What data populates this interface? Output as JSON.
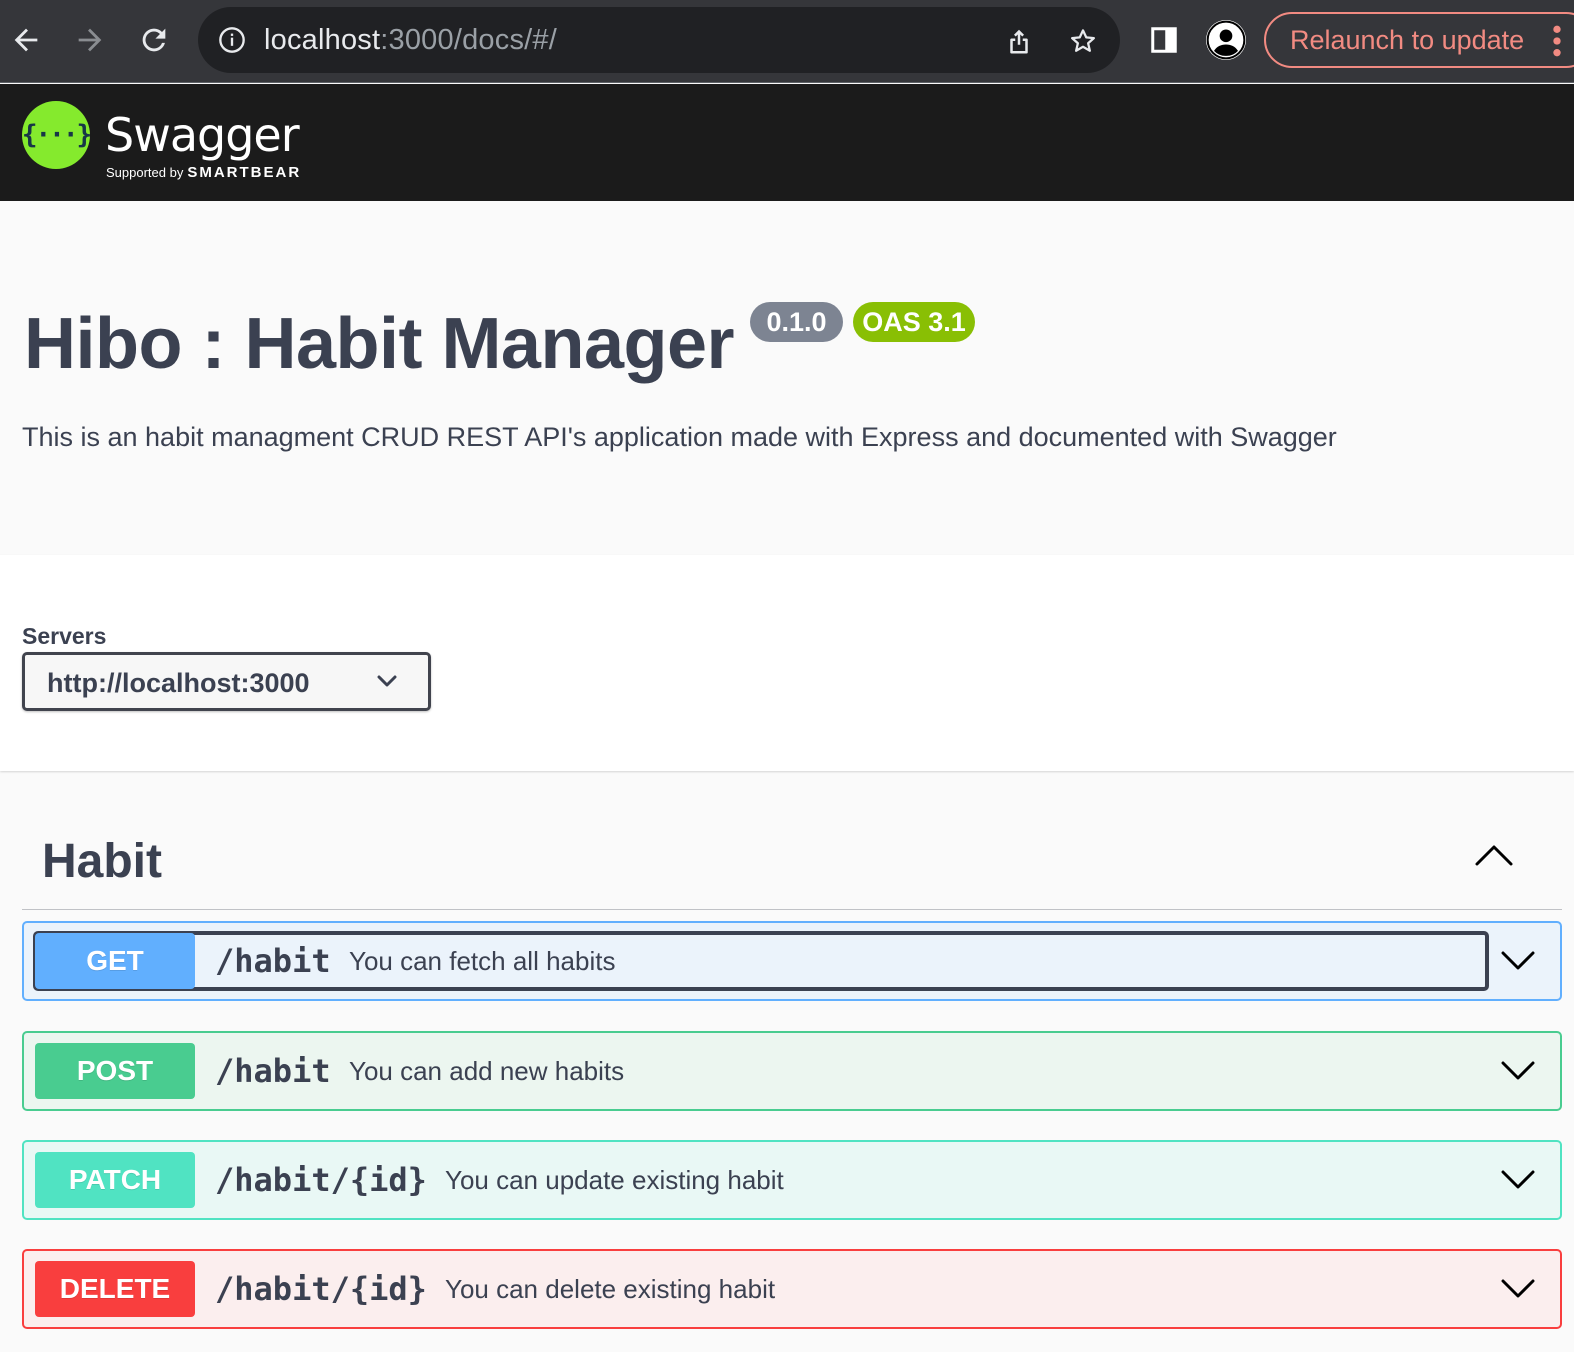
{
  "browser": {
    "url_host": "localhost",
    "url_rest": ":3000/docs/#/",
    "relaunch_label": "Relaunch to update"
  },
  "swagger": {
    "name": "Swagger",
    "supported_by": "Supported by",
    "smartbear": "SMARTBEAR",
    "logo_glyph": "{···}"
  },
  "info": {
    "title": "Hibo : Habit Manager",
    "version": "0.1.0",
    "oas": "OAS 3.1",
    "description": "This is an habit managment CRUD REST API's application made with Express and documented with Swagger"
  },
  "servers": {
    "label": "Servers",
    "selected": "http://localhost:3000"
  },
  "tag": {
    "name": "Habit"
  },
  "operations": [
    {
      "method": "GET",
      "path": "/habit",
      "summary": "You can fetch all habits"
    },
    {
      "method": "POST",
      "path": "/habit",
      "summary": "You can add new habits"
    },
    {
      "method": "PATCH",
      "path": "/habit/{id}",
      "summary": "You can update existing habit"
    },
    {
      "method": "DELETE",
      "path": "/habit/{id}",
      "summary": "You can delete existing habit"
    }
  ],
  "colors": {
    "get": "#61affe",
    "post": "#49cc90",
    "patch": "#50e3c2",
    "delete": "#f93e3e",
    "swagger_green": "#85ea2d"
  }
}
